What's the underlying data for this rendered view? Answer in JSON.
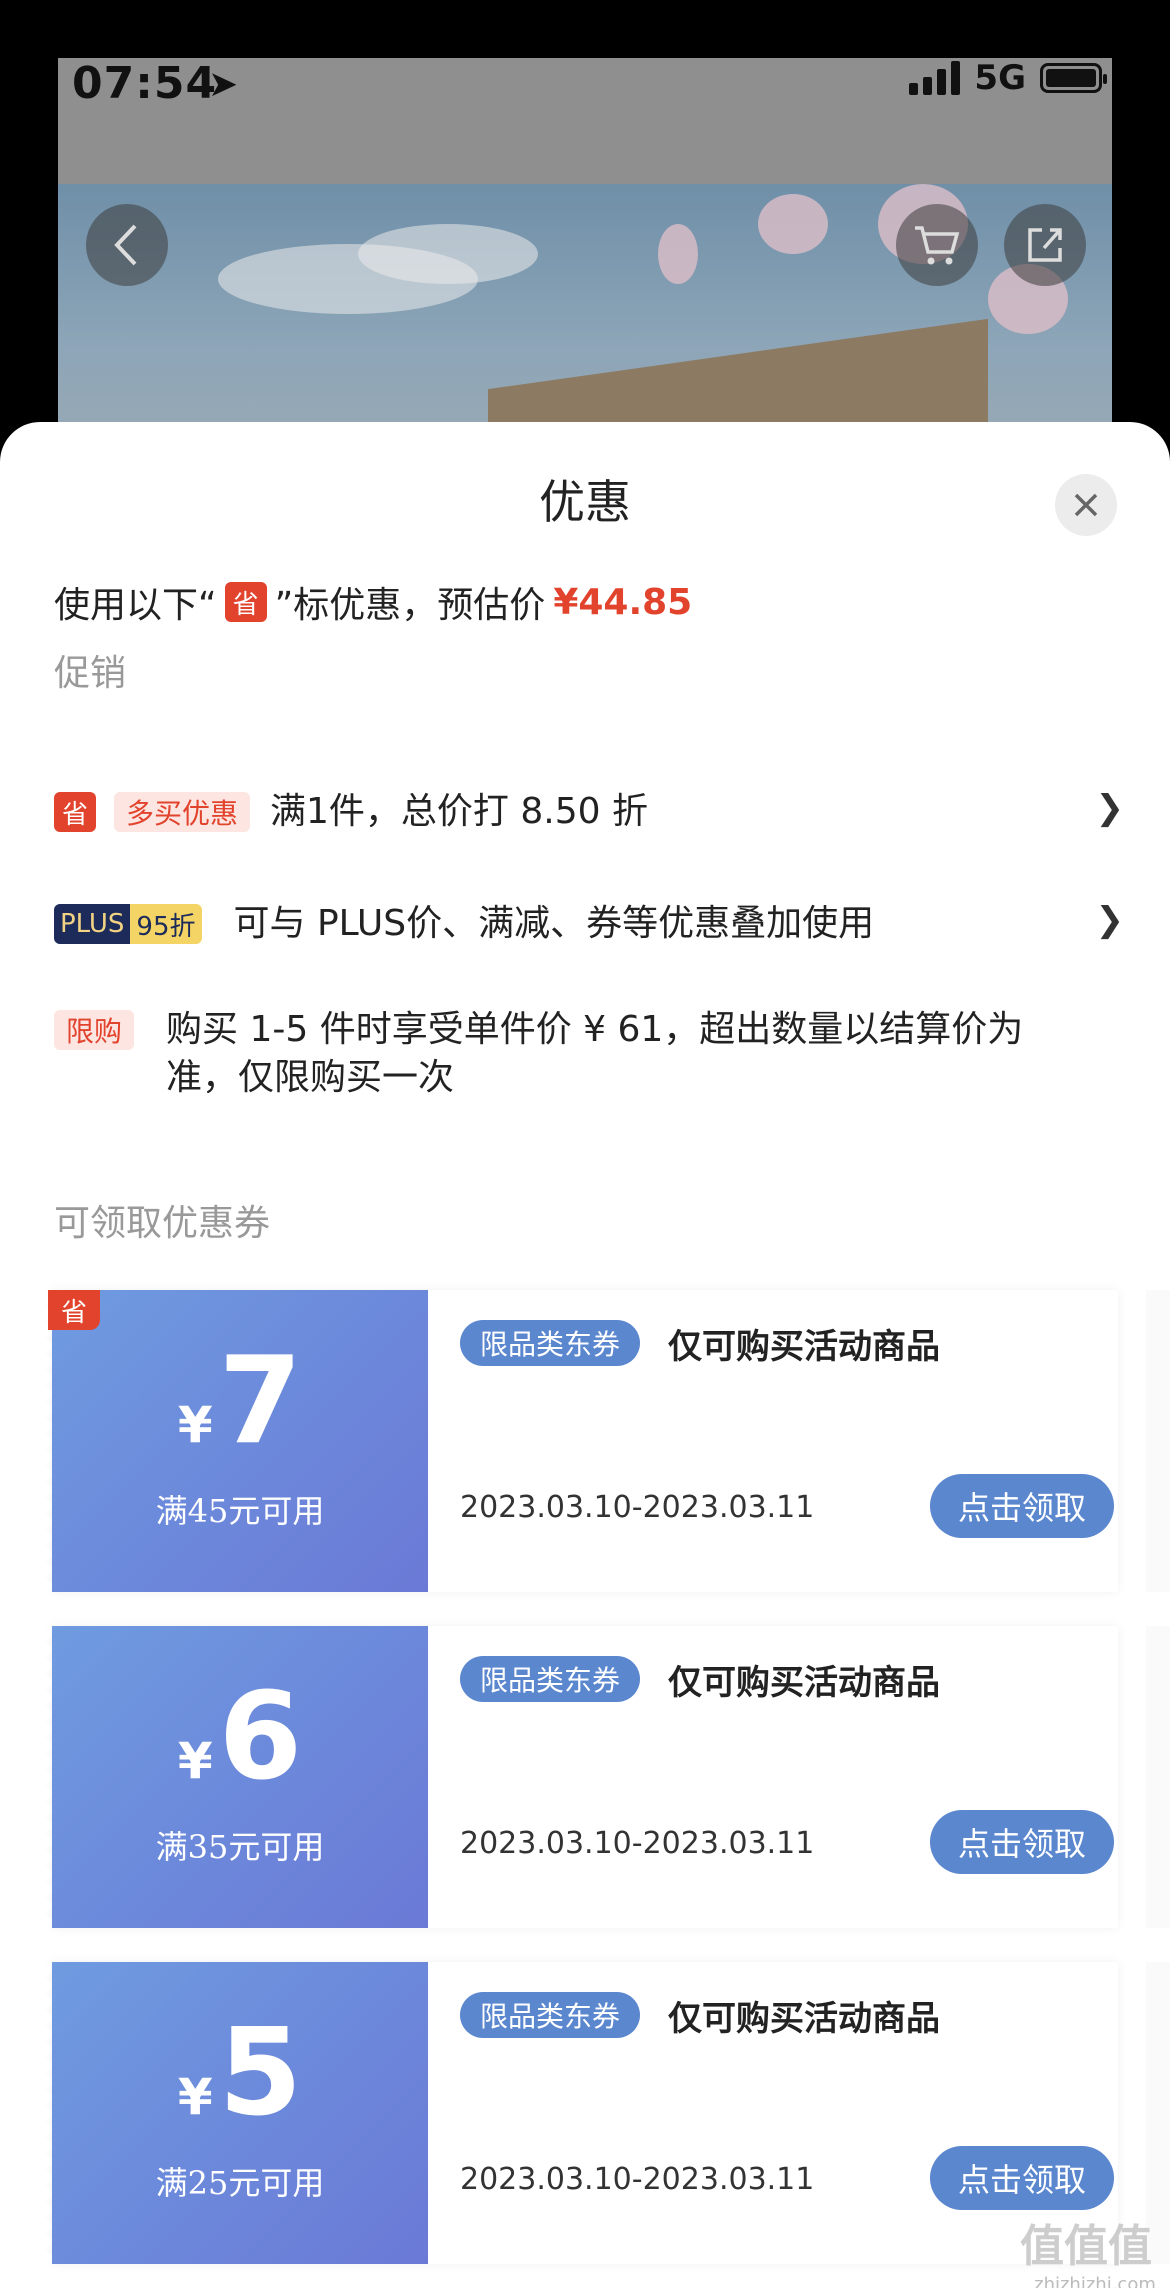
{
  "status_bar": {
    "time": "07:54",
    "network": "5G"
  },
  "sheet": {
    "title": "优惠",
    "summary_prefix": "使用以下“",
    "summary_badge": "省",
    "summary_suffix": "”标优惠，预估价",
    "estimated_price": "¥44.85"
  },
  "promotions": {
    "label": "促销",
    "items": [
      {
        "badge": "省",
        "tag": "多买优惠",
        "text": "满1件，总价打 8.50 折"
      },
      {
        "tag_left": "PLUS",
        "tag_right": "95折",
        "text": "可与 PLUS价、满减、券等优惠叠加使用"
      },
      {
        "tag": "限购",
        "text": "购买 1-5 件时享受单件价 ¥ 61，超出数量以结算价为准，仅限购买一次"
      }
    ]
  },
  "coupons": {
    "label": "可领取优惠券",
    "items": [
      {
        "badge": "省",
        "currency": "¥",
        "amount": "7",
        "condition": "满45元可用",
        "tag": "限品类东券",
        "desc": "仅可购买活动商品",
        "date": "2023.03.10-2023.03.11",
        "button": "点击领取"
      },
      {
        "currency": "¥",
        "amount": "6",
        "condition": "满35元可用",
        "tag": "限品类东券",
        "desc": "仅可购买活动商品",
        "date": "2023.03.10-2023.03.11",
        "button": "点击领取"
      },
      {
        "currency": "¥",
        "amount": "5",
        "condition": "满25元可用",
        "tag": "限品类东券",
        "desc": "仅可购买活动商品",
        "date": "2023.03.10-2023.03.11",
        "button": "点击领取"
      }
    ]
  },
  "watermark": {
    "text": "值值值",
    "site": "zhizhizhi.com"
  },
  "colors": {
    "accent_red": "#e2432d",
    "coupon_blue": "#5b87cf",
    "coupon_gradient_start": "#6f9be0",
    "coupon_gradient_end": "#6a79d6"
  }
}
